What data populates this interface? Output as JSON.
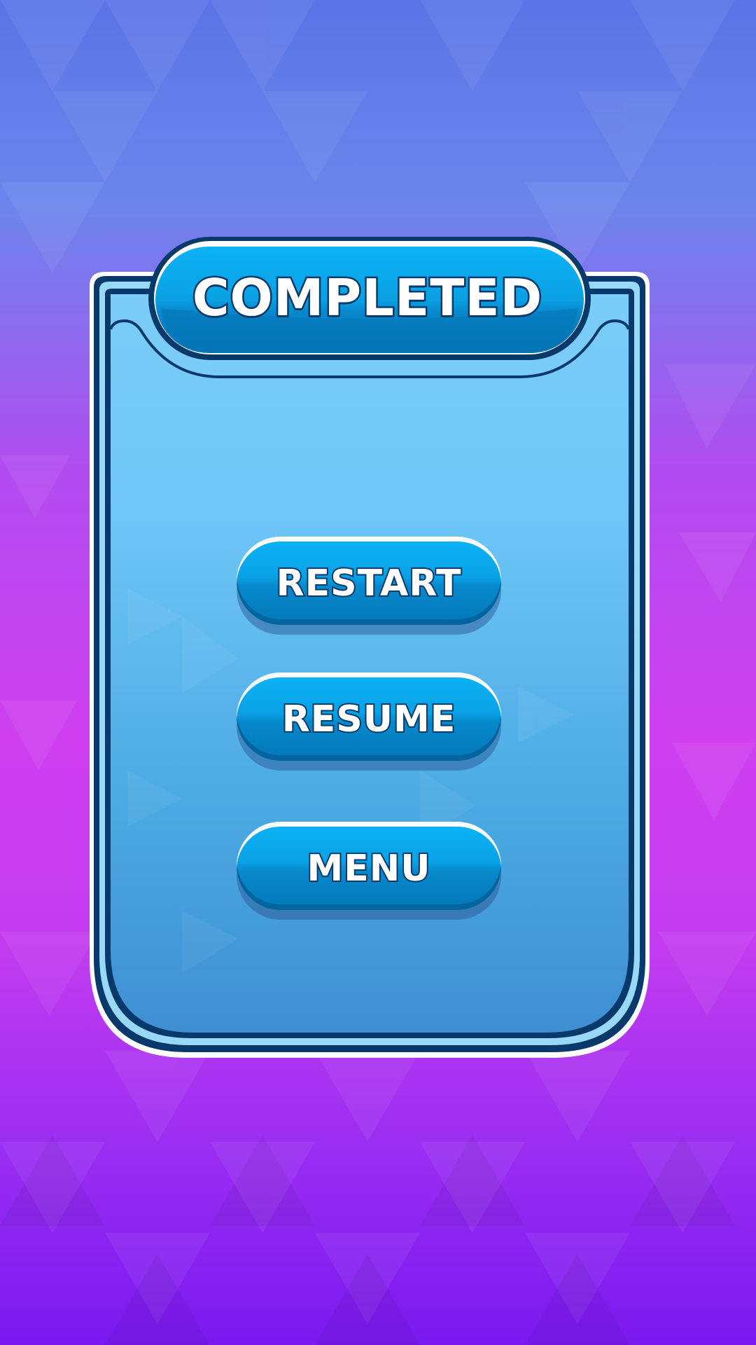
{
  "dialog": {
    "title": "COMPLETED"
  },
  "buttons": {
    "restart_label": "RESTART",
    "resume_label": "RESUME",
    "menu_label": "MENU"
  },
  "colors": {
    "panel_fill": "#6ec6f7",
    "panel_border": "#07396a",
    "button_fill": "#0aa2e6",
    "text_outline": "#07396a"
  }
}
